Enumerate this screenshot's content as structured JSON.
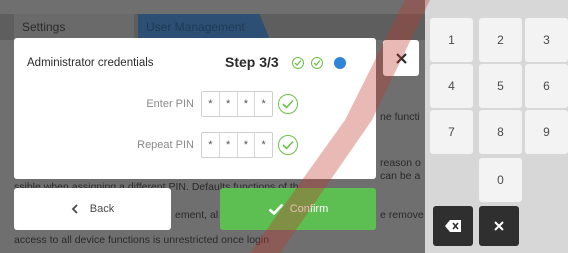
{
  "background": {
    "tabs": [
      "Settings",
      "User Management"
    ],
    "lines": [
      "ne functi",
      "reason o",
      "can be a",
      "ssible when assigning a different PIN. Defaults functions of th",
      "ement, al",
      "e remove",
      "access to all device functions is unrestricted once login"
    ]
  },
  "keypad": {
    "keys": [
      "1",
      "2",
      "3",
      "4",
      "5",
      "6",
      "7",
      "8",
      "9",
      "0"
    ],
    "backspace_icon": "backspace-icon",
    "clear_icon": "close-icon"
  },
  "modal": {
    "title": "Administrator credentials",
    "step": "Step 3/3",
    "step_states": [
      "done",
      "done",
      "active"
    ],
    "fields": [
      {
        "label": "Enter PIN",
        "digits": [
          "*",
          "*",
          "*",
          "*"
        ]
      },
      {
        "label": "Repeat PIN",
        "digits": [
          "*",
          "*",
          "*",
          "*"
        ]
      }
    ]
  },
  "buttons": {
    "back": "Back",
    "confirm": "Confirm"
  },
  "colors": {
    "accent_green": "#5dbf52",
    "step_active": "#2f86d6",
    "check_green": "#6cc04a",
    "watermark": "#c0392b"
  }
}
